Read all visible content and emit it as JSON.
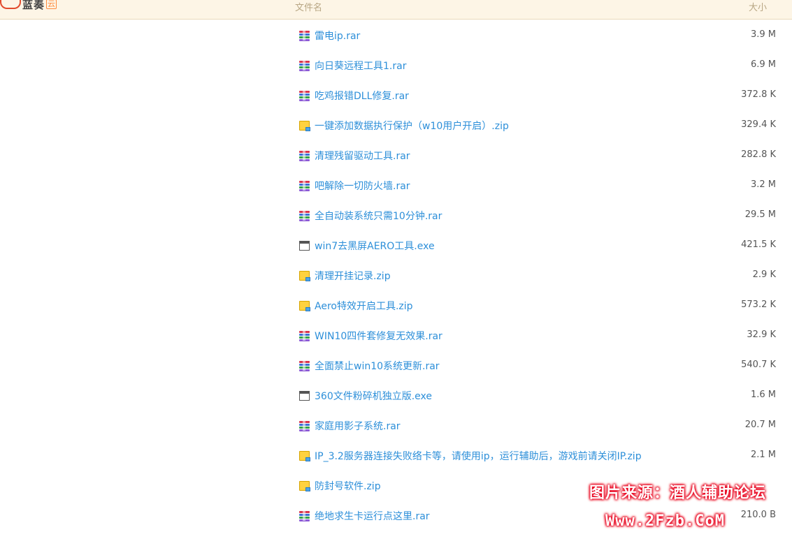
{
  "header": {
    "logo_text": "蓝奏",
    "logo_badge": "云",
    "col_name": "文件名",
    "col_size": "大小"
  },
  "files": [
    {
      "name": "雷电ip.rar",
      "size": "3.9 M",
      "type": "rar"
    },
    {
      "name": "向日葵远程工具1.rar",
      "size": "6.9 M",
      "type": "rar"
    },
    {
      "name": "吃鸡报错DLL修复.rar",
      "size": "372.8 K",
      "type": "rar"
    },
    {
      "name": "一键添加数据执行保护（w10用户开启）.zip",
      "size": "329.4 K",
      "type": "zip"
    },
    {
      "name": "清理残留驱动工具.rar",
      "size": "282.8 K",
      "type": "rar"
    },
    {
      "name": "吧解除一切防火墙.rar",
      "size": "3.2 M",
      "type": "rar"
    },
    {
      "name": "全自动装系统只需10分钟.rar",
      "size": "29.5 M",
      "type": "rar"
    },
    {
      "name": "win7去黑屏AERO工具.exe",
      "size": "421.5 K",
      "type": "exe"
    },
    {
      "name": "清理开挂记录.zip",
      "size": "2.9 K",
      "type": "zip"
    },
    {
      "name": "Aero特效开启工具.zip",
      "size": "573.2 K",
      "type": "zip"
    },
    {
      "name": "WIN10四件套修复无效果.rar",
      "size": "32.9 K",
      "type": "rar"
    },
    {
      "name": "全面禁止win10系统更新.rar",
      "size": "540.7 K",
      "type": "rar"
    },
    {
      "name": "360文件粉碎机独立版.exe",
      "size": "1.6 M",
      "type": "exe"
    },
    {
      "name": "家庭用影子系统.rar",
      "size": "20.7 M",
      "type": "rar"
    },
    {
      "name": "IP_3.2服务器连接失败络卡等，请使用ip，运行辅助后，游戏前请关闭IP.zip",
      "size": "2.1 M",
      "type": "zip"
    },
    {
      "name": "防封号软件.zip",
      "size": "",
      "type": "zip"
    },
    {
      "name": "绝地求生卡运行点这里.rar",
      "size": "210.0 B",
      "type": "rar"
    }
  ],
  "icons": {
    "rar": "archive-rar-icon",
    "zip": "archive-zip-icon",
    "exe": "executable-icon"
  },
  "colors": {
    "link": "#2d8fd9",
    "header_bg": "#fdf5e6",
    "header_text": "#b8a684"
  },
  "watermark": {
    "line1": "图片来源：酒人辅助论坛",
    "line2": "Www.2Fzb.CoM"
  }
}
